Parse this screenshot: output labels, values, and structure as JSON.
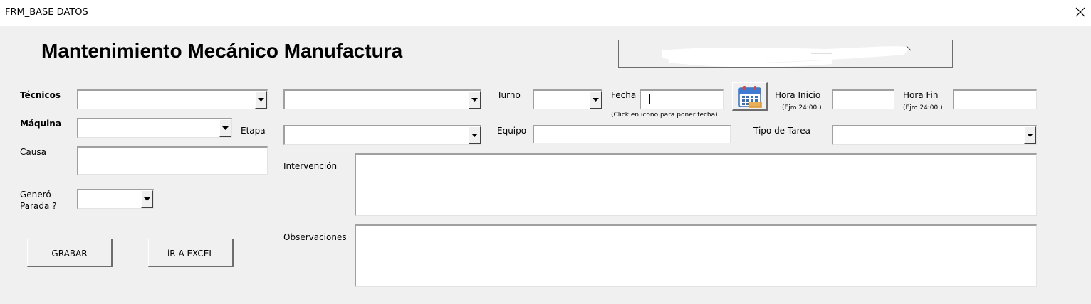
{
  "window": {
    "title": "FRM_BASE DATOS"
  },
  "header": {
    "title": "Mantenimiento Mecánico Manufactura"
  },
  "labels": {
    "tecnicos": "Técnicos",
    "maquina": "Máquina",
    "etapa": "Etapa",
    "causa": "Causa",
    "genero_line1": "Generó",
    "genero_line2": "Parada ?",
    "turno": "Turno",
    "fecha": "Fecha",
    "fecha_hint": "(Click en icono para poner fecha)",
    "hora_inicio": "Hora Inicio",
    "hora_inicio_hint": "(Ejm 24:00 )",
    "hora_fin": "Hora Fin",
    "hora_fin_hint": "(Ejm 24:00 )",
    "equipo": "Equipo",
    "tipo_tarea": "Tipo de Tarea",
    "intervencion": "Intervención",
    "observaciones": "Observaciones"
  },
  "fields": {
    "tecnicos": "",
    "tecnicos2": "",
    "maquina": "",
    "etapa": "",
    "causa": "",
    "genero_parada": "",
    "turno": "",
    "fecha": "",
    "hora_inicio": "",
    "hora_fin": "",
    "equipo": "",
    "tipo_tarea": "",
    "intervencion": "",
    "observaciones": ""
  },
  "buttons": {
    "grabar": "GRABAR",
    "ir_excel": "iR A EXCEL"
  },
  "icons": {
    "close": "close-icon",
    "calendar": "calendar-icon",
    "dropdown": "chevron-down-icon"
  }
}
